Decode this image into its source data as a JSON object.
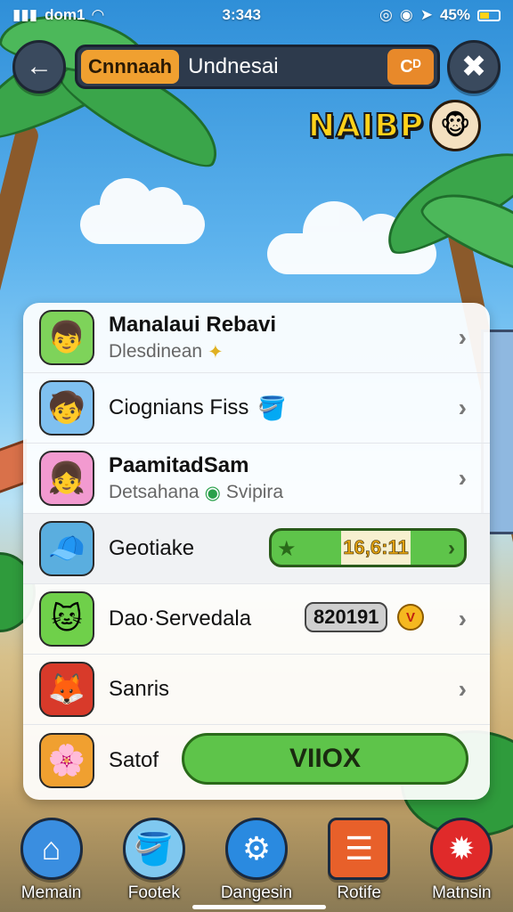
{
  "status_bar": {
    "carrier": "dom1",
    "time": "3:343",
    "battery": "45%",
    "battery_level": 0.45
  },
  "top_bar": {
    "search_chip": "Cnnnaah",
    "search_query": "Undnesai",
    "search_action": "Cᴰ"
  },
  "brand": {
    "title": "NAIBP"
  },
  "list": [
    {
      "avatar_icon": "boy-avatar-icon",
      "avatar_color": "#7ed35a",
      "title": "Manalaui Rebavi",
      "subtitle": "Dlesdinean",
      "subtitle_icon": "sparkle-icon"
    },
    {
      "avatar_icon": "boy-curly-avatar-icon",
      "avatar_color": "#7fc0f0",
      "title": "Ciognians Fiss",
      "subtitle_icon": "bucket-icon"
    },
    {
      "avatar_icon": "girl-avatar-icon",
      "avatar_color": "#f29ad0",
      "title": "PaamitadSam",
      "subtitle": "Detsahana",
      "subtitle_badge": "Svipira"
    },
    {
      "avatar_icon": "cap-boy-avatar-icon",
      "avatar_color": "#5aaedf",
      "title": "Geotiake",
      "progress_value": "16,6:11"
    },
    {
      "avatar_icon": "cat-avatar-icon",
      "avatar_color": "#6fd04a",
      "title": "Dao·Servedala",
      "score": "820191"
    },
    {
      "avatar_icon": "fox-avatar-icon",
      "avatar_color": "#d83a2a",
      "title": "Sanris"
    },
    {
      "avatar_icon": "flower-avatar-icon",
      "avatar_color": "#f0a030",
      "title": "Satof",
      "button_label": "VIIOX"
    }
  ],
  "bottom_nav": [
    {
      "label": "Memain",
      "icon": "home-icon",
      "color": "#3a8ee0"
    },
    {
      "label": "Footek",
      "icon": "bucket-icon",
      "color": "#7fc8f0"
    },
    {
      "label": "Dangesin",
      "icon": "gear-icon",
      "color": "#2a8ae0"
    },
    {
      "label": "Rotife",
      "icon": "list-icon",
      "color": "#e8602a"
    },
    {
      "label": "Matnsin",
      "icon": "settings-icon",
      "color": "#e02a2a"
    }
  ]
}
